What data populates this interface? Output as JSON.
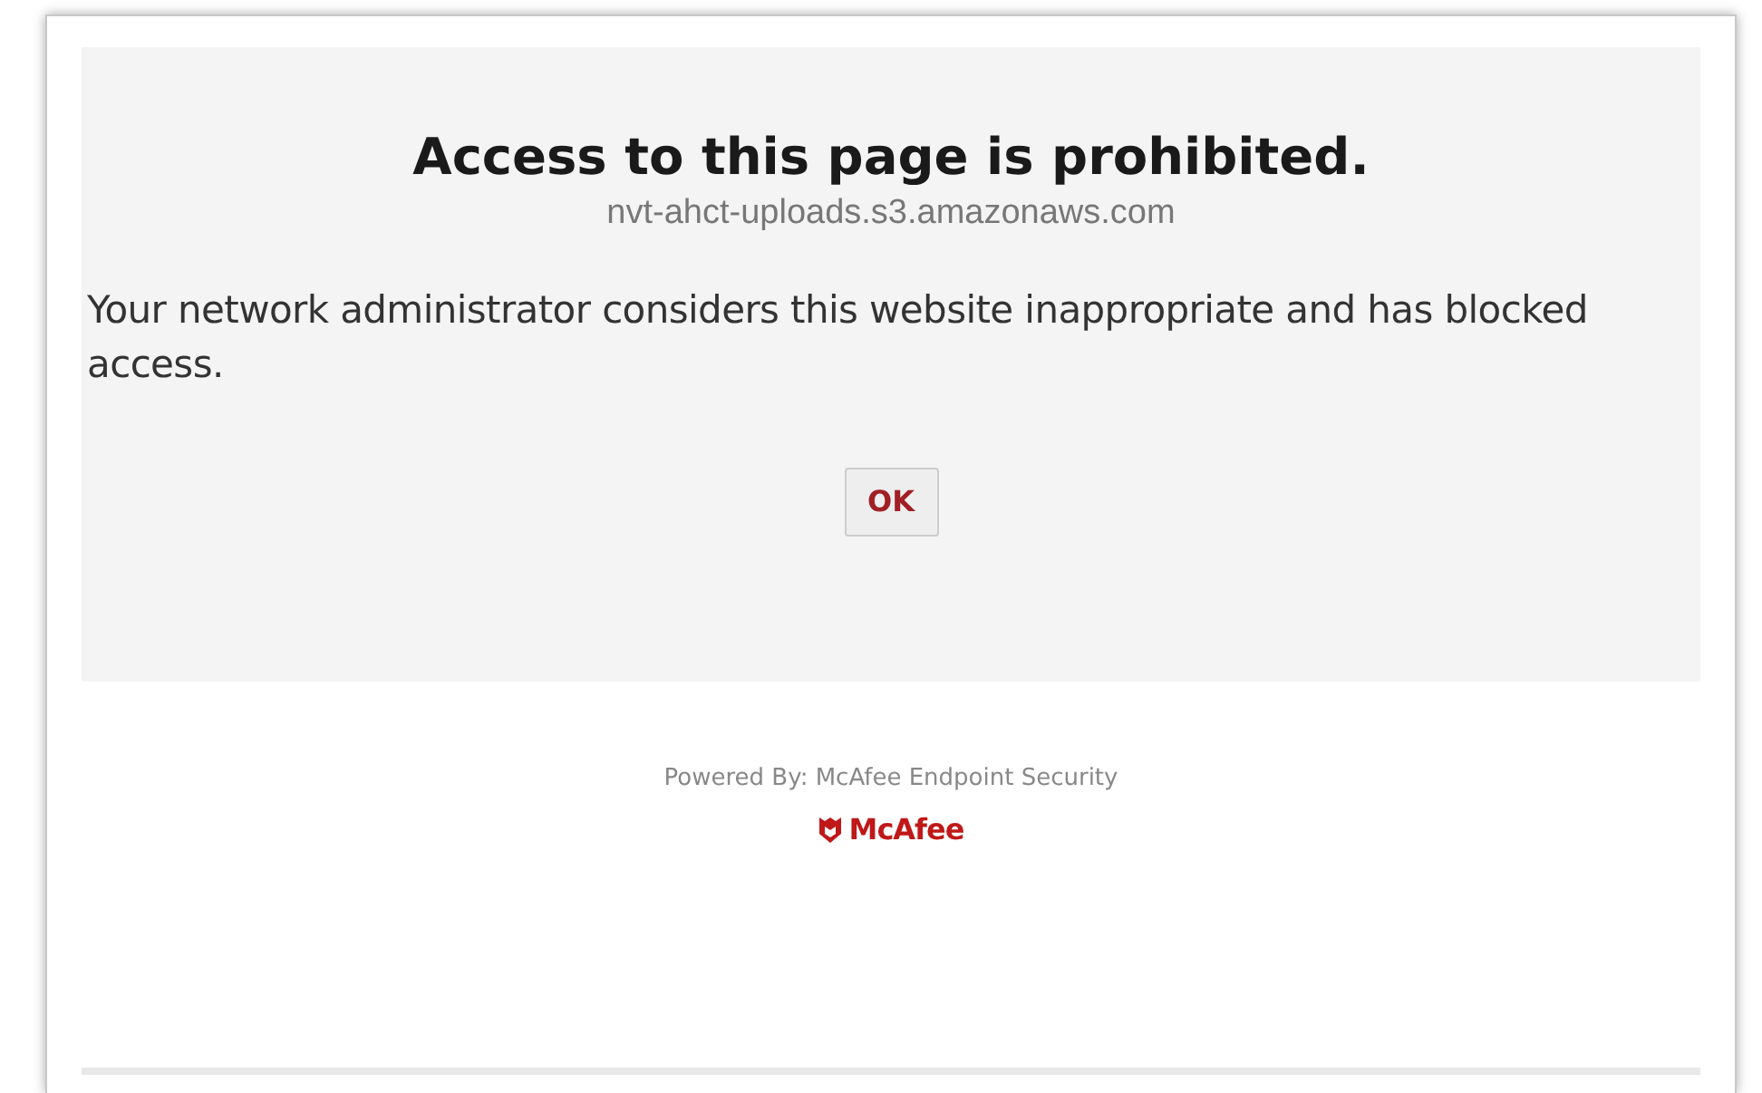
{
  "dialog": {
    "title": "Access to this page is prohibited.",
    "url": "nvt-ahct-uploads.s3.amazonaws.com",
    "message": "Your network administrator considers this website inappropriate and has blocked access.",
    "button": "OK"
  },
  "footer": {
    "powered_by": "Powered By: McAfee Endpoint Security",
    "logo_text": "McAfee"
  }
}
